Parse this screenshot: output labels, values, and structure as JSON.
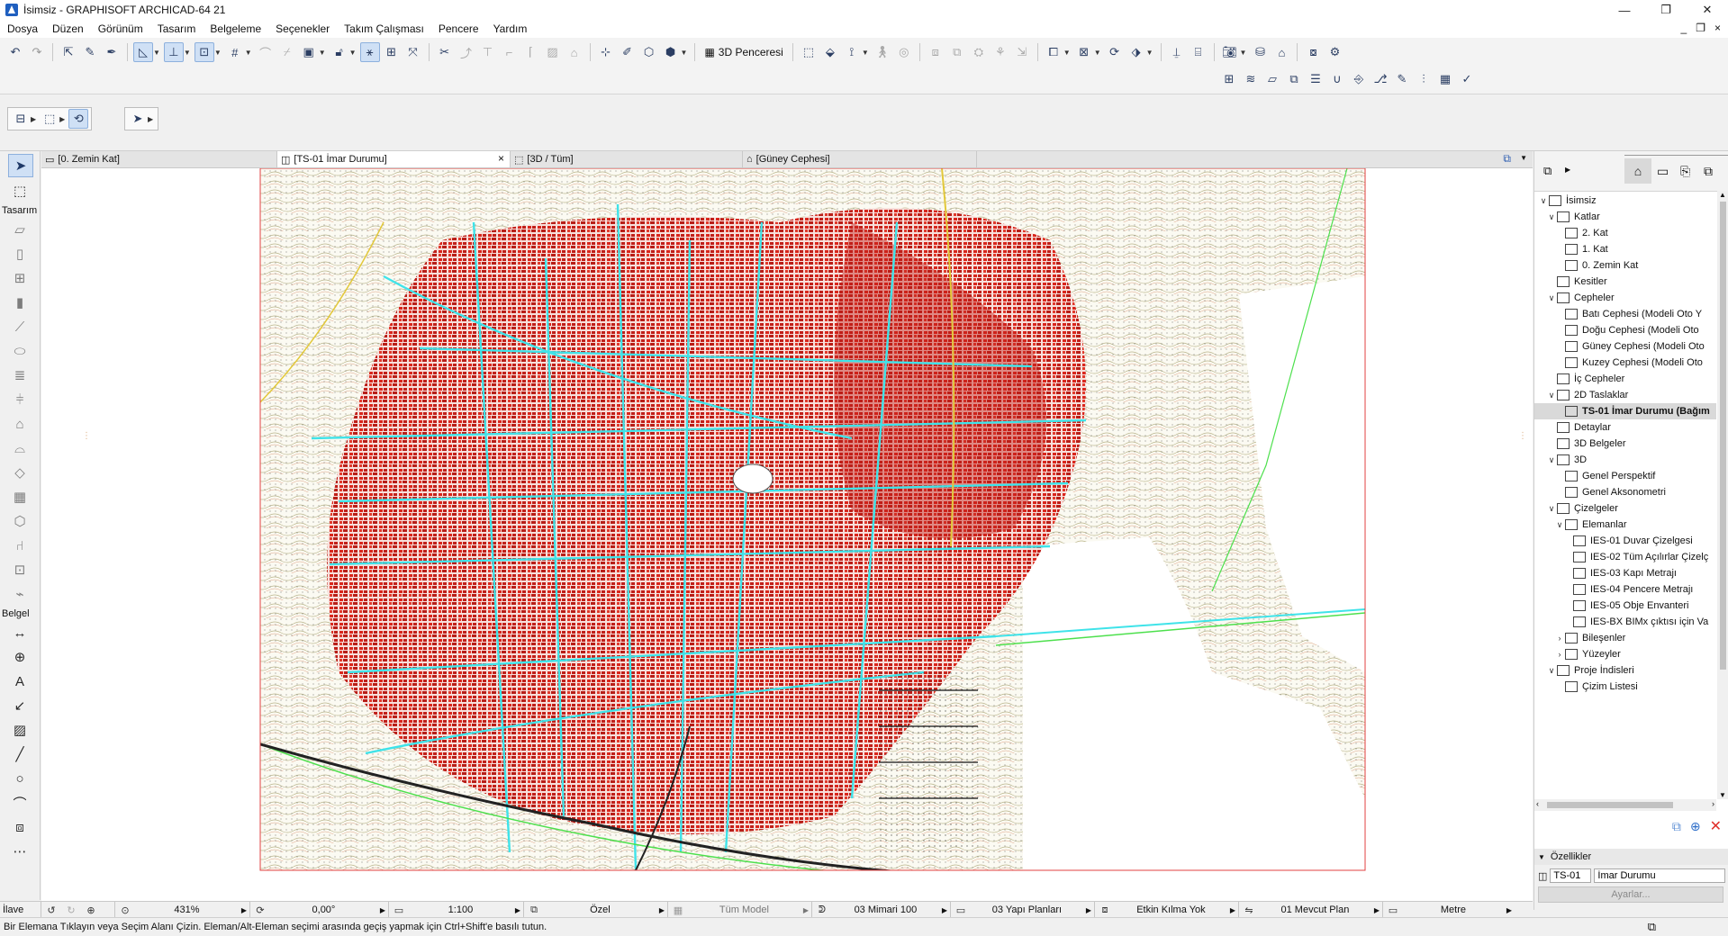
{
  "window": {
    "title": "İsimsiz - GRAPHISOFT ARCHICAD-64 21",
    "minimize": "—",
    "restore": "❐",
    "close": "✕"
  },
  "menu": [
    "Dosya",
    "Düzen",
    "Görünüm",
    "Tasarım",
    "Belgeleme",
    "Seçenekler",
    "Takım Çalışması",
    "Pencere",
    "Yardım"
  ],
  "mdi_controls": {
    "minimize": "_",
    "restore": "❐",
    "close": "×"
  },
  "toolbar": {
    "window_3d_label": "3D Penceresi"
  },
  "toolbox": {
    "design_label": "Tasarım",
    "document_label": "Belgel"
  },
  "tabs": [
    {
      "label": "[0. Zemin Kat]",
      "icon": "floor-plan-icon"
    },
    {
      "label": "[TS-01 İmar Durumu]",
      "icon": "worksheet-icon",
      "close": "×"
    },
    {
      "label": "[3D / Tüm]",
      "icon": "3d-icon"
    },
    {
      "label": "[Güney Cephesi]",
      "icon": "elevation-icon"
    }
  ],
  "navigator": {
    "items": [
      {
        "label": "İsimsiz",
        "level": 0,
        "expand": "∨"
      },
      {
        "label": "Katlar",
        "level": 1,
        "expand": "∨"
      },
      {
        "label": "2. Kat",
        "level": 2,
        "expand": ""
      },
      {
        "label": "1. Kat",
        "level": 2,
        "expand": ""
      },
      {
        "label": "0. Zemin Kat",
        "level": 2,
        "expand": ""
      },
      {
        "label": "Kesitler",
        "level": 1,
        "expand": ""
      },
      {
        "label": "Cepheler",
        "level": 1,
        "expand": "∨"
      },
      {
        "label": "Batı Cephesi (Modeli Oto Y",
        "level": 2,
        "expand": ""
      },
      {
        "label": "Doğu Cephesi (Modeli Oto",
        "level": 2,
        "expand": ""
      },
      {
        "label": "Güney Cephesi (Modeli Oto",
        "level": 2,
        "expand": ""
      },
      {
        "label": "Kuzey Cephesi (Modeli Oto",
        "level": 2,
        "expand": ""
      },
      {
        "label": "İç Cepheler",
        "level": 1,
        "expand": ""
      },
      {
        "label": "2D Taslaklar",
        "level": 1,
        "expand": "∨"
      },
      {
        "label": "TS-01 İmar Durumu (Bağım",
        "level": 2,
        "expand": "",
        "selected": true
      },
      {
        "label": "Detaylar",
        "level": 1,
        "expand": ""
      },
      {
        "label": "3D Belgeler",
        "level": 1,
        "expand": ""
      },
      {
        "label": "3D",
        "level": 1,
        "expand": "∨"
      },
      {
        "label": "Genel Perspektif",
        "level": 2,
        "expand": ""
      },
      {
        "label": "Genel Aksonometri",
        "level": 2,
        "expand": ""
      },
      {
        "label": "Çizelgeler",
        "level": 1,
        "expand": "∨"
      },
      {
        "label": "Elemanlar",
        "level": 2,
        "expand": "∨"
      },
      {
        "label": "IES-01 Duvar Çizelgesi",
        "level": 3,
        "expand": ""
      },
      {
        "label": "IES-02 Tüm Açılırlar Çizelç",
        "level": 3,
        "expand": ""
      },
      {
        "label": "IES-03 Kapı Metrajı",
        "level": 3,
        "expand": ""
      },
      {
        "label": "IES-04 Pencere Metrajı",
        "level": 3,
        "expand": ""
      },
      {
        "label": "IES-05 Obje Envanteri",
        "level": 3,
        "expand": ""
      },
      {
        "label": "IES-BX BIMx çıktısı için Va",
        "level": 3,
        "expand": ""
      },
      {
        "label": "Bileşenler",
        "level": 2,
        "expand": "›"
      },
      {
        "label": "Yüzeyler",
        "level": 2,
        "expand": "›"
      },
      {
        "label": "Proje İndisleri",
        "level": 1,
        "expand": "∨"
      },
      {
        "label": "Çizim Listesi",
        "level": 2,
        "expand": ""
      }
    ]
  },
  "properties": {
    "title": "Özellikler",
    "id": "TS-01",
    "name": "İmar Durumu",
    "settings": "Ayarlar..."
  },
  "quick_options": {
    "mode": "İlave",
    "zoom": "431%",
    "angle": "0,00°",
    "scale": "1:100",
    "layer_combo": "Özel",
    "model_view": "Tüm Model",
    "pen_set": "03 Mimari 100",
    "mvo": "03 Yapı Planları",
    "override": "Etkin Kılma Yok",
    "renovation": "01 Mevcut Plan",
    "dimension": "Metre"
  },
  "status": {
    "message": "Bir Elemana Tıklayın veya Seçim Alanı Çizin.  Eleman/Alt-Eleman seçimi arasında geçiş yapmak için Ctrl+Shift'e basılı tutun."
  },
  "colors": {
    "road": "#3fe3e9",
    "building": "#d9261c",
    "contour": "#c8c8a0",
    "selection": "#cfe0f5"
  }
}
